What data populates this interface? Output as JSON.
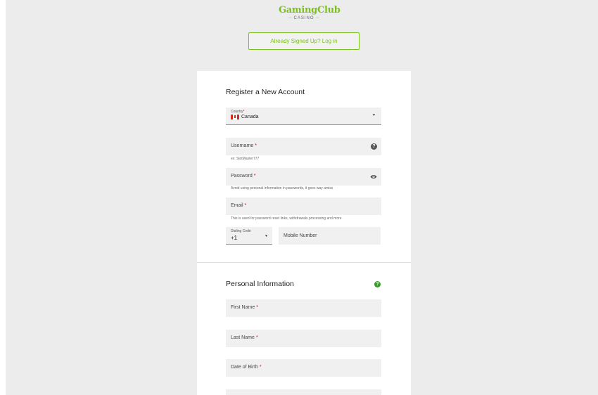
{
  "logo": {
    "main": "GamingClub",
    "sub": "CASINO"
  },
  "login_button": "Already Signed Up? Log in",
  "register": {
    "title": "Register a New Account",
    "country": {
      "label": "Country",
      "value": "Canada"
    },
    "username": {
      "label": "Username",
      "hint": "ex: SlotMaster777"
    },
    "password": {
      "label": "Password",
      "hint": "Avoid using personal information in passwords, it goes way amiss"
    },
    "email": {
      "label": "Email",
      "hint": "This is used for password reset links, withdrawals processing and more"
    },
    "dialing": {
      "label": "Dialing Code",
      "value": "+1"
    },
    "mobile": {
      "label": "Mobile Number"
    }
  },
  "personal": {
    "title": "Personal Information",
    "first_name": "First Name",
    "last_name": "Last Name",
    "dob": "Date of Birth"
  },
  "required_mark": "*",
  "colors": {
    "accent": "#7cc11e",
    "focus_line": "#6bb52a",
    "required": "#d0021b",
    "help_green": "#3a9a2c"
  }
}
